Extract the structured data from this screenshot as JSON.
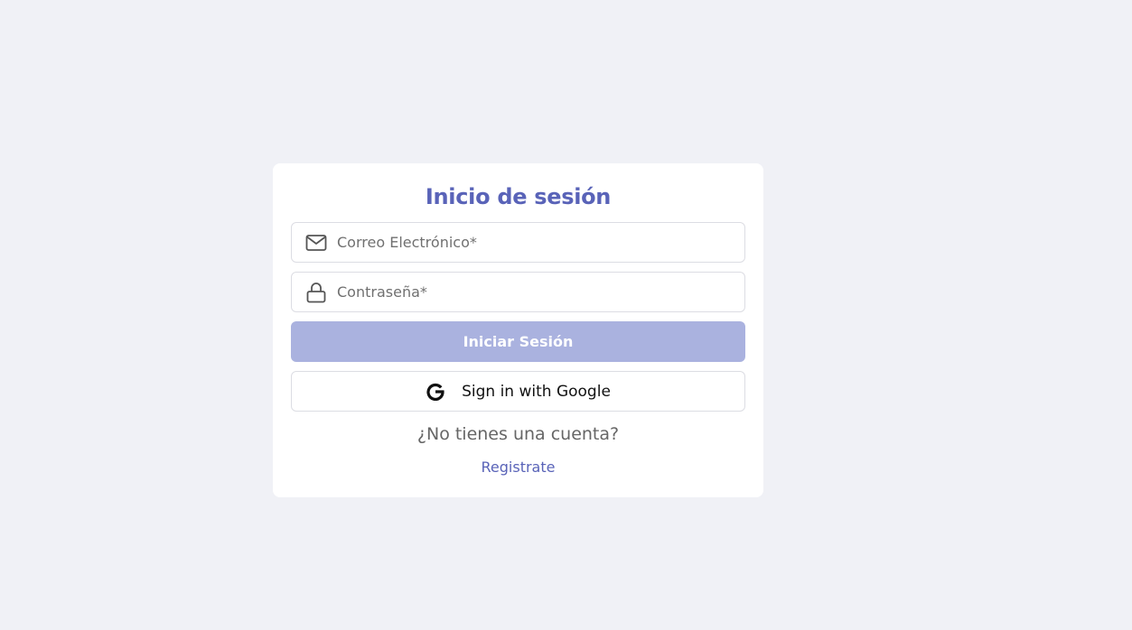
{
  "login": {
    "title": "Inicio de sesión",
    "email": {
      "placeholder": "Correo Electrónico*",
      "value": "",
      "icon": "mail-icon"
    },
    "password": {
      "placeholder": "Contraseña*",
      "value": "",
      "icon": "lock-icon"
    },
    "submit_label": "Iniciar Sesión",
    "google_label": "Sign in with Google",
    "google_icon": "google-g-icon",
    "no_account_text": "¿No tienes una cuenta?",
    "register_link": "Registrate"
  },
  "colors": {
    "background": "#f0f1f6",
    "accent": "#5963b8",
    "button_disabled": "#aab2df",
    "muted_text": "#666666"
  }
}
